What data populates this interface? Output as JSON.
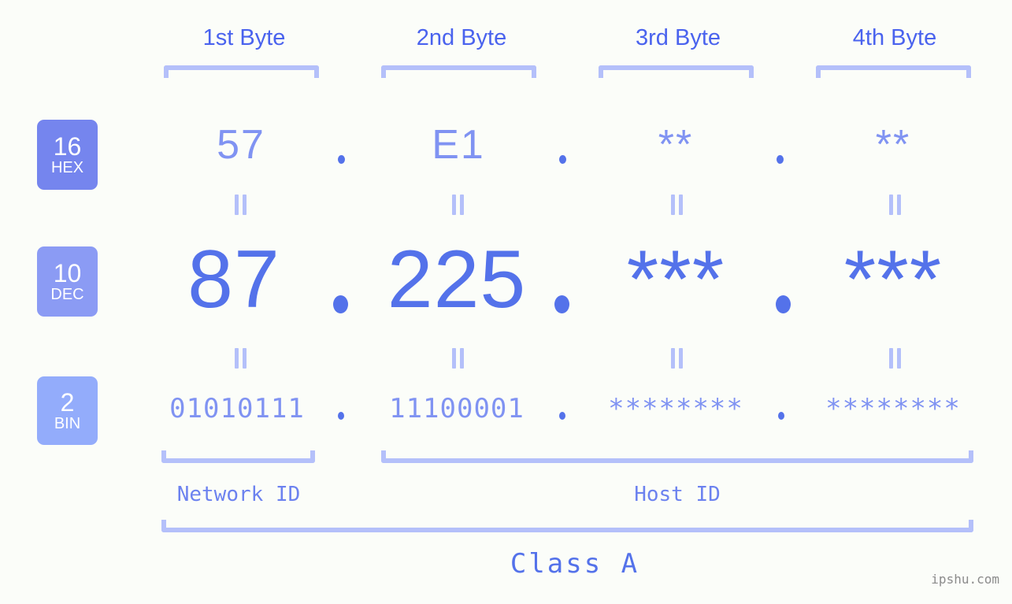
{
  "background_color": "#fbfdf9",
  "accent_colors": {
    "header_blue": "#4a63ee",
    "bracket_blue": "#b4c0fa",
    "hex_blue": "#8093f2",
    "dec_blue": "#5472ea",
    "bin_blue": "#8093f2",
    "badge_hex": "#7585ee",
    "badge_dec": "#8b9bf4",
    "badge_bin": "#93acfb",
    "watermark_gray": "#8b8b8b"
  },
  "byte_headers": [
    {
      "label": "1st Byte"
    },
    {
      "label": "2nd Byte"
    },
    {
      "label": "3rd Byte"
    },
    {
      "label": "4th Byte"
    }
  ],
  "bases": [
    {
      "number": "16",
      "name": "HEX"
    },
    {
      "number": "10",
      "name": "DEC"
    },
    {
      "number": "2",
      "name": "BIN"
    }
  ],
  "rows": {
    "hex": {
      "values": [
        "57",
        "E1",
        "**",
        "**"
      ]
    },
    "dec": {
      "values": [
        "87",
        "225",
        "***",
        "***"
      ]
    },
    "bin": {
      "values": [
        "01010111",
        "11100001",
        "********",
        "********"
      ]
    }
  },
  "separator": ".",
  "id_labels": {
    "network": "Network ID",
    "host": "Host ID"
  },
  "class_label": "Class A",
  "watermark": "ipshu.com",
  "ip_address": {
    "hex": "57.E1.**.**",
    "dec": "87.225.***.***",
    "bin": "01010111.11100001.********.********"
  }
}
